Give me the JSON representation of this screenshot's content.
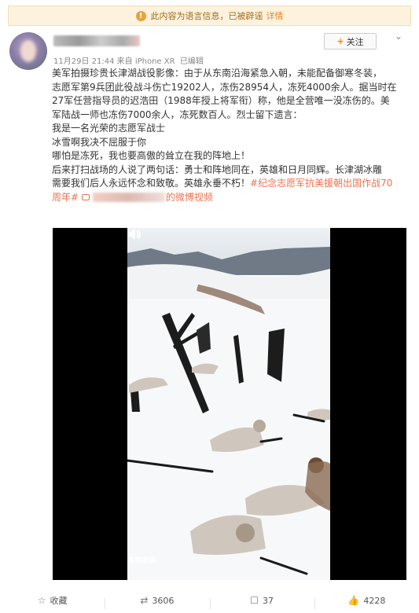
{
  "notice": {
    "icon": "info-icon",
    "text": "此内容为语言信息，已被辟谣",
    "link": "详情"
  },
  "author": {
    "name": "",
    "time": "11月29日 21:44",
    "source_prefix": "来自",
    "source": "iPhone XR",
    "edited": "已编辑",
    "follow_label": "关注"
  },
  "post": {
    "lines": [
      "美军拍摄珍贵长津湖战役影像：由于从东南沿海紧急入朝，未能配备御寒冬装，",
      "志愿军第9兵团此役战斗伤亡19202人，冻伤28954人，冻死4000余人。据当时在",
      "27军任营指导员的迟浩田（1988年授上将军衔）称，他是全营唯一没冻伤的。美",
      "军陆战一师也冻伤7000余人，冻死数百人。烈士留下遗言：",
      "我是一名光荣的志愿军战士",
      "冰雪啊我决不屈服于你",
      "哪怕是冻死，我也要高傲的耸立在我的阵地上！",
      "后来打扫战场的人说了两句话：勇士和阵地同在，英雄和日月同辉。长津湖冰雕",
      "需要我们后人永远怀念和致敬。英雄永垂不朽！"
    ],
    "hashtag_part1": "#纪念志愿军抗美援朝出国作战70",
    "hashtag_part2": "周年#",
    "video_link_suffix": "的微博视频"
  },
  "video": {
    "watermark": "视频提供",
    "speaker_icon": "speaker-icon"
  },
  "actions": {
    "favorite": "收藏",
    "repost": "3606",
    "comment": "37",
    "like": "4228"
  },
  "colors": {
    "notice_bg": "#fdf2de",
    "notice_text": "#a06c1a",
    "link": "#eb7350",
    "follow_plus": "#ff8200"
  }
}
